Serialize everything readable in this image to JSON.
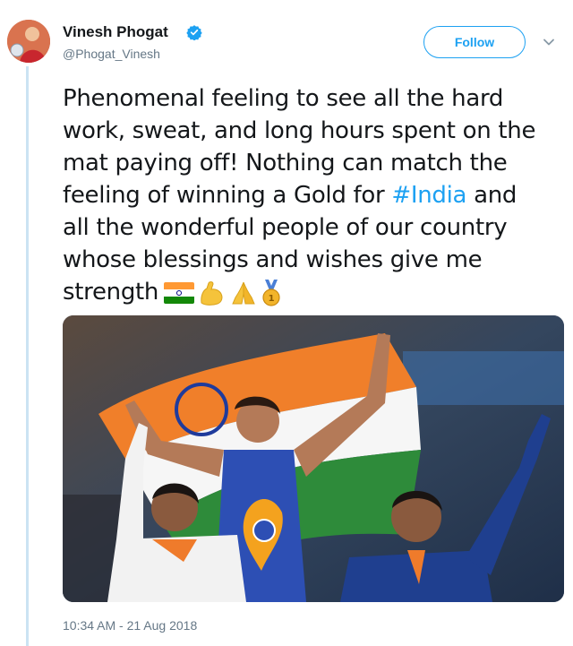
{
  "author": {
    "name": "Vinesh Phogat",
    "handle": "@Phogat_Vinesh",
    "avatar_icon": "profile-photo"
  },
  "follow_label": "Follow",
  "tweet": {
    "lines": [
      "Phenomenal feeling to see all the hard",
      "work, sweat, and long hours spent on the",
      "mat paying off! Nothing can match the",
      "all the wonderful people of our country",
      "whose blessings and wishes give me"
    ],
    "line4_prefix": "feeling of winning a Gold for ",
    "hashtag": "#India",
    "line4_suffix": " and",
    "last_line": "strength",
    "emojis": [
      "india-flag-emoji",
      "flexed-biceps-emoji",
      "folded-hands-emoji",
      "medal-emoji"
    ]
  },
  "timestamp": "10:34 AM - 21 Aug 2018",
  "colors": {
    "accent": "#1da1f2",
    "muted": "#657786",
    "text": "#14171a"
  }
}
